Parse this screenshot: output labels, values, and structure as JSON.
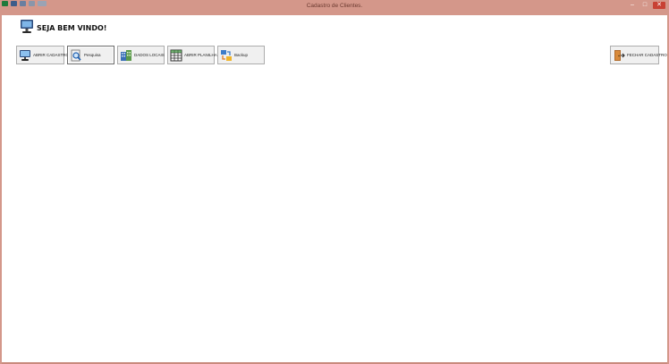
{
  "window": {
    "title": "Cadastro de Clientes.",
    "controls": {
      "minimize": "–",
      "maximize": "□",
      "close": "✕"
    }
  },
  "header": {
    "welcome_text": "SEJA BEM VINDO!"
  },
  "toolbar": {
    "buttons": [
      {
        "label": "ABRIR CADASTRO",
        "icon": "computer-monitor-icon"
      },
      {
        "label": "Pesquisa",
        "icon": "document-search-icon"
      },
      {
        "label": "DADOS LOCAIS",
        "icon": "building-icon"
      },
      {
        "label": "ABRIR PLANILHA",
        "icon": "spreadsheet-icon"
      },
      {
        "label": "Backup",
        "icon": "backup-sync-icon"
      },
      {
        "label": "FECHAR CADASTRO",
        "icon": "exit-door-icon"
      }
    ]
  },
  "colors": {
    "window_frame": "#d4978a",
    "close_button": "#c84134",
    "client_background": "#ffffff",
    "button_background": "#f0f0f0"
  }
}
